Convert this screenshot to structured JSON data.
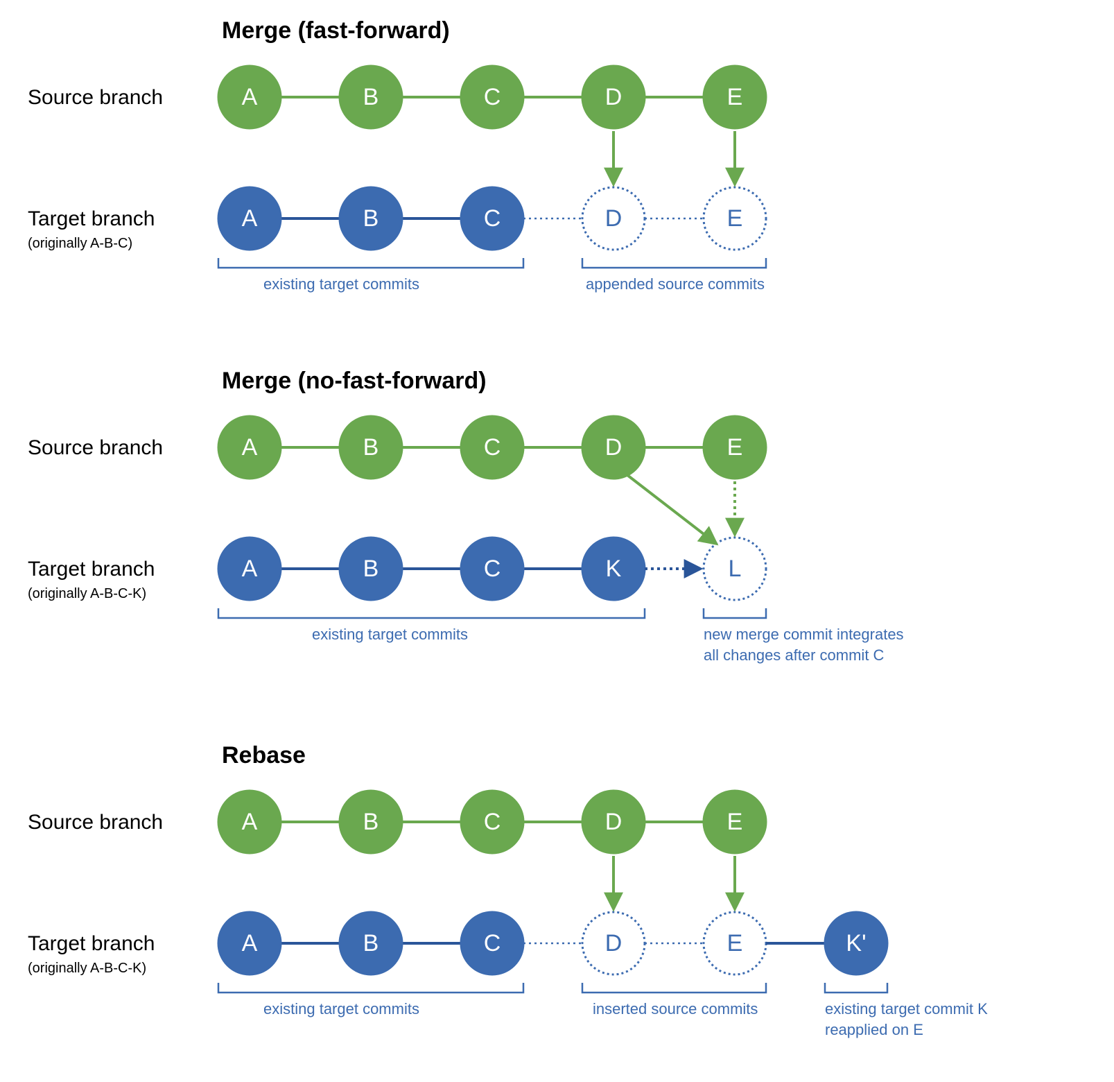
{
  "colors": {
    "green": "#6aa84f",
    "blue": "#3c6bb0",
    "darkblue": "#2a5599"
  },
  "section1": {
    "title": "Merge (fast-forward)",
    "source_label": "Source branch",
    "target_label": "Target branch",
    "target_sub": "(originally A-B-C)",
    "source_nodes": [
      "A",
      "B",
      "C",
      "D",
      "E"
    ],
    "target_nodes_solid": [
      "A",
      "B",
      "C"
    ],
    "target_nodes_dotted": [
      "D",
      "E"
    ],
    "caption_left": "existing target commits",
    "caption_right": "appended source commits"
  },
  "section2": {
    "title": "Merge (no-fast-forward)",
    "source_label": "Source branch",
    "target_label": "Target branch",
    "target_sub": "(originally A-B-C-K)",
    "source_nodes": [
      "A",
      "B",
      "C",
      "D",
      "E"
    ],
    "target_nodes_solid": [
      "A",
      "B",
      "C",
      "K"
    ],
    "target_nodes_dotted": [
      "L"
    ],
    "caption_left": "existing target commits",
    "caption_right1": "new merge commit integrates",
    "caption_right2": "all changes after commit C"
  },
  "section3": {
    "title": "Rebase",
    "source_label": "Source branch",
    "target_label": "Target branch",
    "target_sub": "(originally A-B-C-K)",
    "source_nodes": [
      "A",
      "B",
      "C",
      "D",
      "E"
    ],
    "target_nodes_solid_left": [
      "A",
      "B",
      "C"
    ],
    "target_nodes_dotted": [
      "D",
      "E"
    ],
    "target_nodes_solid_right": [
      "K'"
    ],
    "caption_left": "existing target commits",
    "caption_mid": "inserted source commits",
    "caption_right1": "existing target commit K",
    "caption_right2": "reapplied on E"
  }
}
